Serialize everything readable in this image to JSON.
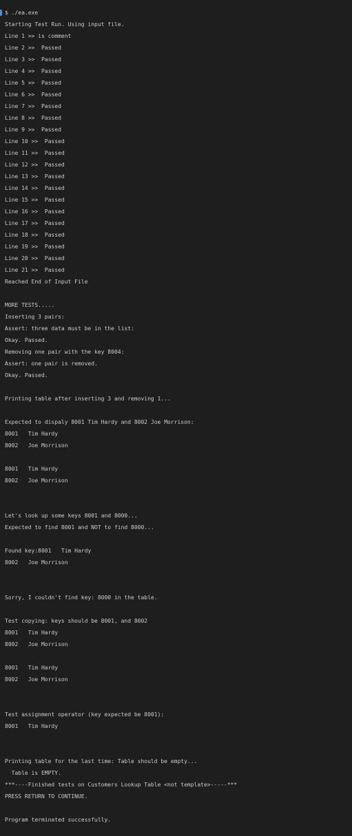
{
  "terminal": {
    "lines": [
      "$ ./ea.exe",
      "Starting Test Run. Using input file.",
      "Line 1 >> is comment",
      "Line 2 >>  Passed",
      "Line 3 >>  Passed",
      "Line 4 >>  Passed",
      "Line 5 >>  Passed",
      "Line 6 >>  Passed",
      "Line 7 >>  Passed",
      "Line 8 >>  Passed",
      "Line 9 >>  Passed",
      "Line 10 >>  Passed",
      "Line 11 >>  Passed",
      "Line 12 >>  Passed",
      "Line 13 >>  Passed",
      "Line 14 >>  Passed",
      "Line 15 >>  Passed",
      "Line 16 >>  Passed",
      "Line 17 >>  Passed",
      "Line 18 >>  Passed",
      "Line 19 >>  Passed",
      "Line 20 >>  Passed",
      "Line 21 >>  Passed",
      "Reached End of Input File",
      "",
      "MORE TESTS.....",
      "Inserting 3 pairs:",
      "Assert: three data must be in the list:",
      "Okay. Passed.",
      "Removing one pair with the key 8004:",
      "Assert: one pair is removed.",
      "Okay. Passed.",
      "",
      "Printing table after inserting 3 and removing 1...",
      "",
      "Expected to dispaly 8001 Tim Hardy and 8002 Joe Morrison:",
      "8001   Tim Hardy",
      "8002   Joe Morrison",
      "",
      "8001   Tim Hardy",
      "8002   Joe Morrison",
      "",
      "",
      "Let's look up some keys 8001 and 8000...",
      "Expected to find 8001 and NOT to find 8000...",
      "",
      "Found key:8001   Tim Hardy",
      "8002   Joe Morrison",
      "",
      "",
      "Sorry, I couldn't find key: 8000 in the table.",
      "",
      "Test copying: keys should be 8001, and 8002",
      "8001   Tim Hardy",
      "8002   Joe Morrison",
      "",
      "8001   Tim Hardy",
      "8002   Joe Morrison",
      "",
      "",
      "Test assignment operator (key expected be 8001):",
      "8001   Tim Hardy",
      "",
      "",
      "Printing table for the last time: Table should be empty...",
      "  Table is EMPTY.",
      "***----Finished tests on Customers Lookup Table <not template>-----***",
      "PRESS RETURN TO CONTINUE.",
      "",
      "Program terminated successfully."
    ]
  }
}
